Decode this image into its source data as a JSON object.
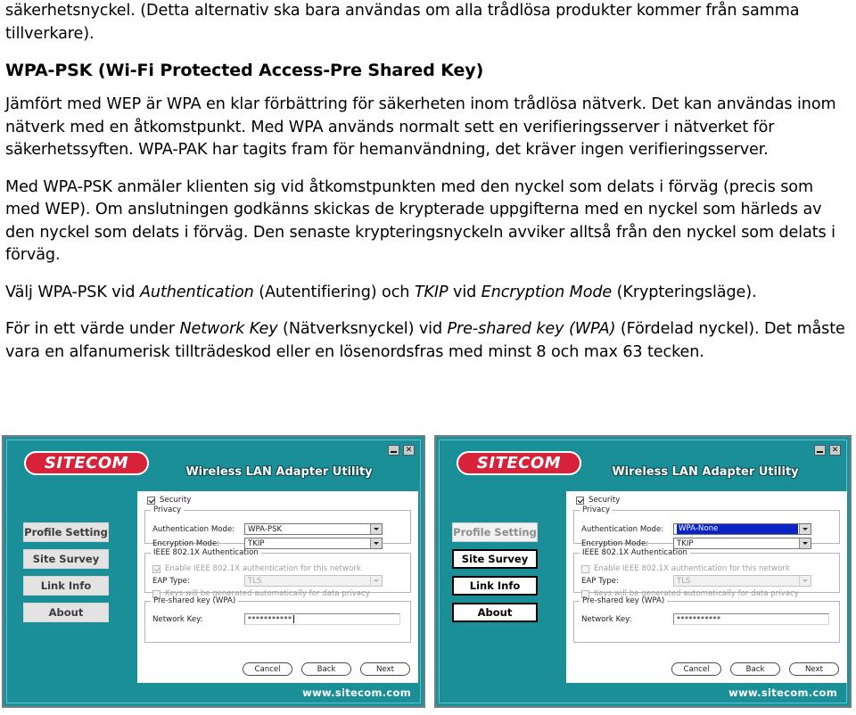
{
  "document": {
    "paragraphs": [
      "säkerhetsnyckel. (Detta alternativ ska bara användas om alla trådlösa produkter kommer från samma tillverkare)."
    ],
    "heading": "WPA-PSK (Wi-Fi Protected Access-Pre Shared Key)",
    "p_wep": "Jämfört med WEP är WPA en klar förbättring för säkerheten inom trådlösa nätverk. Det kan användas inom nätverk med en åtkomstpunkt. Med WPA används normalt sett en verifieringsserver i nätverket för säkerhetssyften. WPA-PAK har tagits fram för hemanvändning, det kräver ingen verifieringsserver.",
    "p_psk": "Med WPA-PSK anmäler klienten sig vid åtkomstpunkten med den nyckel som delats i förväg (precis som med WEP). Om anslutningen godkänns skickas de krypterade uppgifterna med en nyckel som härleds av den nyckel som delats i förväg. Den senaste krypteringsnyckeln avviker alltså från den nyckel som delats i förväg.",
    "p_valj": {
      "t1": "Välj WPA-PSK vid ",
      "i1": "Authentication",
      "t2": " (Autentifiering) och ",
      "i2": "TKIP",
      "t3": " vid ",
      "i3": "Encryption Mode",
      "t4": " (Krypteringsläge)."
    },
    "p_nyckel": {
      "t1": "För in ett värde under ",
      "i1": "Network Key",
      "t2": " (Nätverksnyckel) vid ",
      "i2": "Pre-shared key (WPA)",
      "t3": " (Fördelad nyckel). Det måste vara en alfanumerisk tillträdeskod eller en lösenordsfras med minst 8 och max 63 tecken."
    }
  },
  "colors": {
    "teal": "#1b8f98",
    "logo_red": "#d8223a",
    "select_highlight": "#0a24c8"
  },
  "screenshot_left": {
    "brand": "SITECOM",
    "app_title": "Wireless LAN Adapter Utility",
    "window_controls": {
      "minimize": "minimize-icon",
      "close": "✕"
    },
    "nav": [
      {
        "label": "Profile Setting",
        "state": "active"
      },
      {
        "label": "Site Survey",
        "state": "normal"
      },
      {
        "label": "Link Info",
        "state": "normal"
      },
      {
        "label": "About",
        "state": "normal"
      }
    ],
    "form": {
      "security_label": "Security",
      "security_checked": true,
      "privacy_legend": "Privacy",
      "auth_mode_label": "Authentication Mode:",
      "auth_mode_value": "WPA-PSK",
      "auth_mode_highlighted": false,
      "encryption_mode_label": "Encryption Mode:",
      "encryption_mode_value": "TKIP",
      "dot1x_legend": "IEEE 802.1X Authentication",
      "dot1x_enable_label": "Enable IEEE 802.1X authentication for this network",
      "dot1x_enable_checked": true,
      "eap_type_label": "EAP Type:",
      "eap_type_value": "TLS",
      "keys_auto_label": "Keys will be generated automatically for data privacy",
      "keys_auto_checked": false,
      "psk_legend": "Pre-shared key (WPA)",
      "network_key_label": "Network Key:",
      "network_key_value": "***********"
    },
    "buttons": {
      "cancel": "Cancel",
      "back": "Back",
      "next": "Next"
    },
    "footer": "www.sitecom.com"
  },
  "screenshot_right": {
    "brand": "SITECOM",
    "app_title": "Wireless LAN Adapter Utility",
    "window_controls": {
      "minimize": "minimize-icon",
      "close": "✕"
    },
    "nav": [
      {
        "label": "Profile Setting",
        "state": "disabled"
      },
      {
        "label": "Site Survey",
        "state": "normal"
      },
      {
        "label": "Link Info",
        "state": "normal"
      },
      {
        "label": "About",
        "state": "normal"
      }
    ],
    "form": {
      "security_label": "Security",
      "security_checked": true,
      "privacy_legend": "Privacy",
      "auth_mode_label": "Authentication Mode:",
      "auth_mode_value": "WPA-None",
      "auth_mode_highlighted": true,
      "encryption_mode_label": "Encryption Mode:",
      "encryption_mode_value": "TKIP",
      "dot1x_legend": "IEEE 802.1X Authentication",
      "dot1x_enable_label": "Enable IEEE 802.1X authentication for this network",
      "dot1x_enable_checked": false,
      "eap_type_label": "EAP Type:",
      "eap_type_value": "TLS",
      "keys_auto_label": "Keys will be generated automatically for data privacy",
      "keys_auto_checked": false,
      "psk_legend": "Pre-shared key (WPA)",
      "network_key_label": "Network Key:",
      "network_key_value": "***********"
    },
    "buttons": {
      "cancel": "Cancel",
      "back": "Back",
      "next": "Next"
    },
    "footer": "www.sitecom.com"
  }
}
